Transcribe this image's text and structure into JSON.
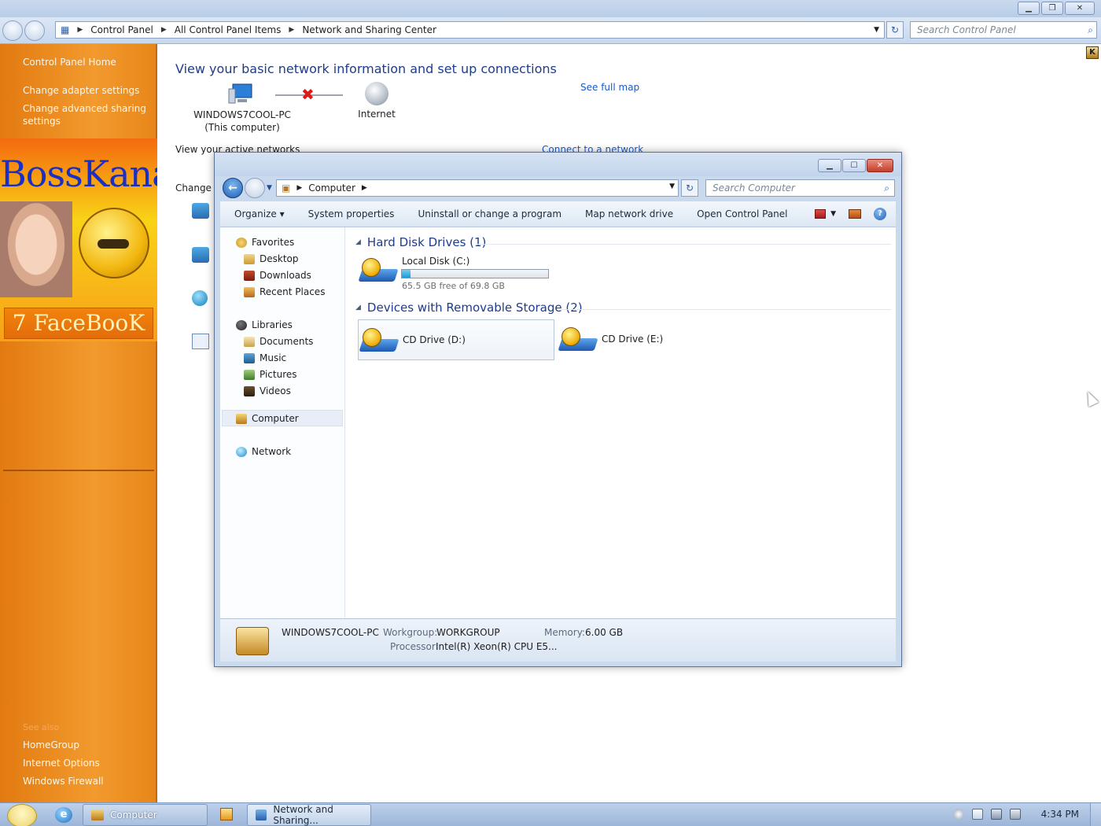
{
  "background_window": {
    "breadcrumbs": [
      "Control Panel",
      "All Control Panel Items",
      "Network and Sharing Center"
    ],
    "search_placeholder": "Search Control Panel",
    "left_nav": {
      "home": "Control Panel Home",
      "adapter": "Change adapter settings",
      "sharing_line1": "Change advanced sharing",
      "sharing_line2": "settings",
      "see_also": "See also",
      "homegroup": "HomeGroup",
      "internet_options": "Internet Options",
      "firewall": "Windows Firewall"
    },
    "promo": {
      "title": "BossKanae",
      "banner": "7 FaceBooK"
    },
    "main": {
      "heading": "View your basic network information and set up connections",
      "see_full_map": "See full map",
      "computer_name": "WINDOWS7COOL-PC",
      "computer_sub": "(This computer)",
      "internet": "Internet",
      "view_active": "View your active networks",
      "connect": "Connect to a network",
      "change": "Change y"
    }
  },
  "computer_window": {
    "address_crumb": "Computer",
    "search_placeholder": "Search Computer",
    "commands": [
      "Organize",
      "System properties",
      "Uninstall or change a program",
      "Map network drive",
      "Open Control Panel"
    ],
    "organize_caret": "▾",
    "nav": {
      "favorites": "Favorites",
      "desktop": "Desktop",
      "downloads": "Downloads",
      "recent": "Recent Places",
      "libraries": "Libraries",
      "documents": "Documents",
      "music": "Music",
      "pictures": "Pictures",
      "videos": "Videos",
      "computer": "Computer",
      "network": "Network"
    },
    "groups": {
      "hdd": "Hard Disk Drives (1)",
      "removable": "Devices with Removable Storage (2)"
    },
    "drives": {
      "c_name": "Local Disk (C:)",
      "c_free": "65.5 GB free of 69.8 GB",
      "c_used_fraction": 0.06,
      "d_name": "CD Drive (D:)",
      "e_name": "CD Drive (E:)"
    },
    "details": {
      "name": "WINDOWS7COOL-PC",
      "workgroup_label": "Workgroup:",
      "workgroup": "WORKGROUP",
      "memory_label": "Memory:",
      "memory": "6.00 GB",
      "processor_label": "Processor:",
      "processor": "Intel(R) Xeon(R) CPU E5..."
    }
  },
  "taskbar": {
    "computer_btn": "Computer",
    "network_btn": "Network and Sharing...",
    "time": "4:34 PM"
  }
}
